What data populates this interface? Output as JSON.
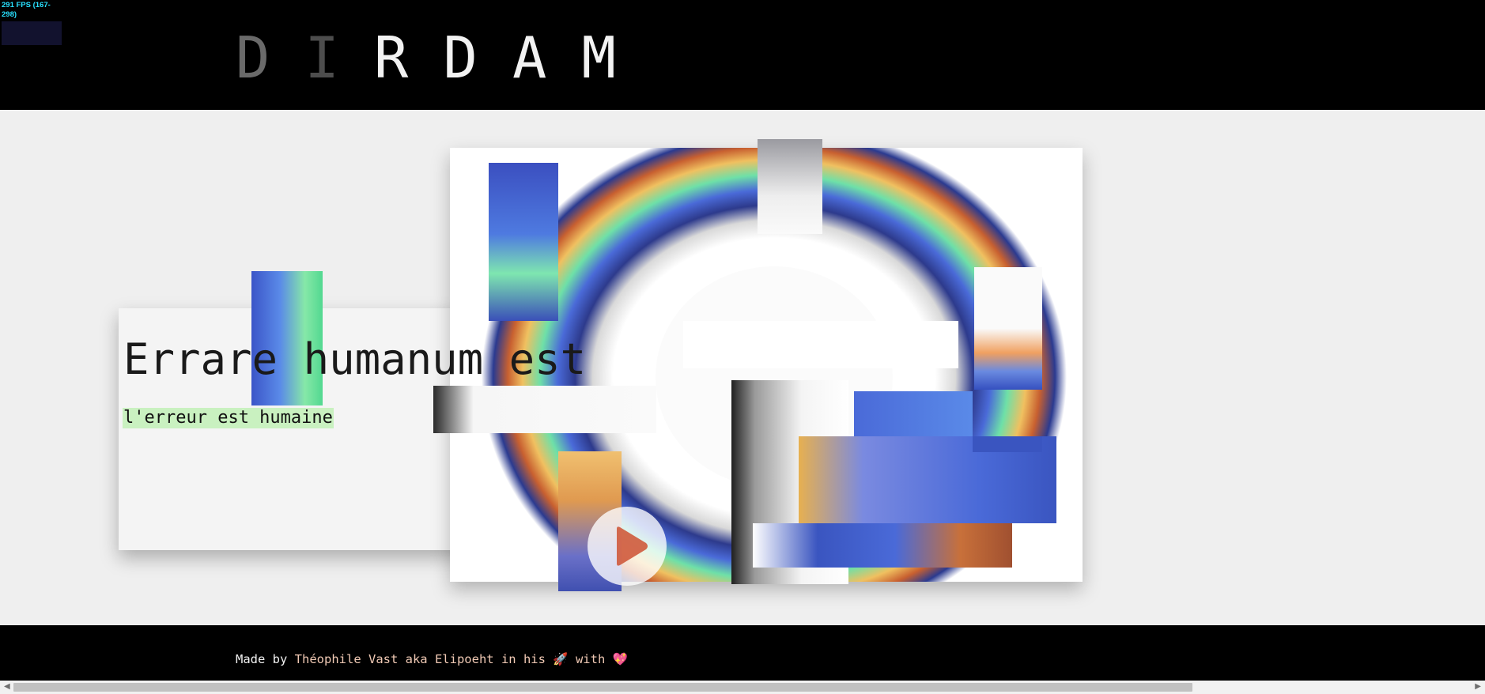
{
  "fps_meter": {
    "label": "291 FPS (167-298)"
  },
  "header": {
    "logo_letters": [
      "D",
      "I",
      "R",
      "D",
      "A",
      "M"
    ]
  },
  "hero": {
    "title": "Errare humanum est",
    "subtitle": "l'erreur est humaine",
    "play_icon": "play-icon"
  },
  "footer": {
    "made_by": "Made by",
    "author": "Théophile Vast aka Elipoeht in his",
    "rocket": "🚀",
    "with": "with",
    "heart": "💖"
  },
  "colors": {
    "header_bg": "#000000",
    "page_bg": "#efefef",
    "subtitle_highlight": "#c9f1c0",
    "footer_author": "#f0c9b4",
    "fps_text": "#28e0ff"
  }
}
